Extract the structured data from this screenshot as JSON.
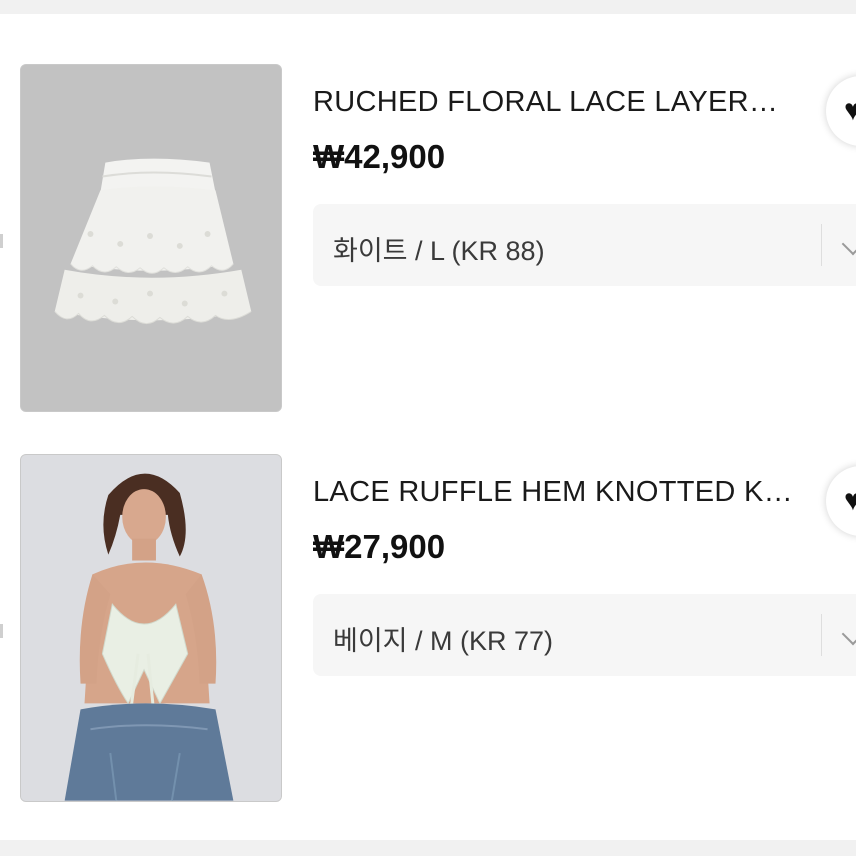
{
  "items": [
    {
      "image_alt": "white ruched lace layered skirt",
      "title": "RUCHED FLORAL LACE LAYER…",
      "price": "₩42,900",
      "option": "화이트 / L (KR 88)",
      "like_icon": "heart-icon"
    },
    {
      "image_alt": "model wearing lace ruffle tie-front cami with denim skirt",
      "title": "LACE RUFFLE HEM KNOTTED K…",
      "price": "₩27,900",
      "option": "베이지 / M (KR 77)",
      "like_icon": "heart-icon"
    }
  ],
  "colors": {
    "background": "#f1f1f1",
    "card": "#ffffff",
    "option_bg": "#f6f6f6",
    "text": "#111111"
  }
}
